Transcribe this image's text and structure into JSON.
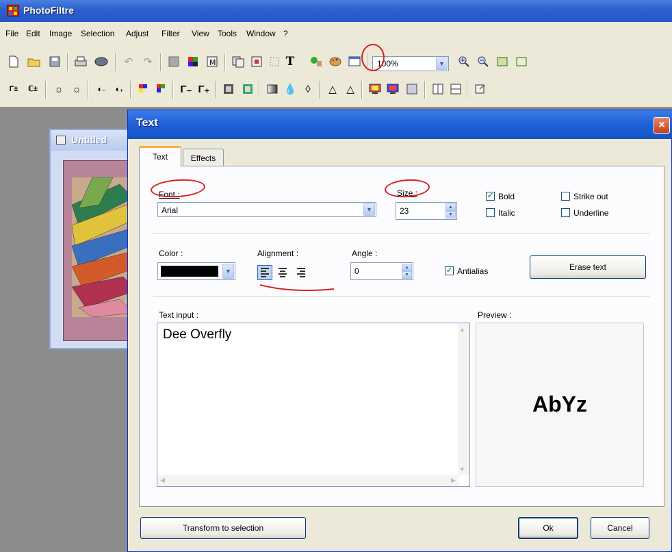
{
  "app": {
    "title": "PhotoFiltre"
  },
  "menu": [
    "File",
    "Edit",
    "Image",
    "Selection",
    "Adjust",
    "Filter",
    "View",
    "Tools",
    "Window",
    "?"
  ],
  "toolbar": {
    "zoom_value": "100%",
    "row1_icons": [
      "new-icon",
      "open-icon",
      "save-icon",
      "print-icon",
      "scan-icon",
      "undo-icon",
      "redo-icon",
      "grey-square-icon",
      "color-grid-icon",
      "mask-icon",
      "copy-icon",
      "paste-icon",
      "crop-icon",
      "text-icon",
      "tree-icon",
      "palette-icon",
      "window-icon",
      "zoom-in-icon",
      "zoom-out-icon",
      "fit-icon",
      "actual-size-icon"
    ],
    "row2_icons": [
      "auto-levels-icon",
      "auto-contrast-icon",
      "brightness-minus-icon",
      "brightness-plus-icon",
      "contrast-minus-icon",
      "contrast-plus-icon",
      "saturation-minus-icon",
      "saturation-plus-icon",
      "gamma-minus-icon",
      "gamma-plus-icon",
      "grayscale-icon",
      "color-grid-icon",
      "gradient-icon",
      "drop-icon",
      "drop-outline-icon",
      "triangle-icon",
      "triangle-outline-icon",
      "monitor-icon",
      "monitor-alt-icon",
      "dither-icon",
      "book-icon",
      "frame-icon",
      "export-icon"
    ]
  },
  "image_window": {
    "title": "Untitled"
  },
  "dialog": {
    "title": "Text",
    "close": "×",
    "tabs": [
      {
        "label": "Text",
        "active": true
      },
      {
        "label": "Effects",
        "active": false
      }
    ],
    "font": {
      "label": "Font :",
      "value": "Arial"
    },
    "size": {
      "label": "Size :",
      "value": "23"
    },
    "style": {
      "bold": {
        "label": "Bold",
        "checked": true
      },
      "italic": {
        "label": "Italic",
        "checked": false
      },
      "strikeout": {
        "label": "Strike out",
        "checked": false
      },
      "underline": {
        "label": "Underline",
        "checked": false
      }
    },
    "color": {
      "label": "Color :",
      "value": "#000000"
    },
    "alignment": {
      "label": "Alignment :",
      "selected": "left"
    },
    "angle": {
      "label": "Angle :",
      "value": "0"
    },
    "antialias": {
      "label": "Antialias",
      "checked": true
    },
    "erase_button": "Erase text",
    "text_input": {
      "label": "Text input :",
      "value": "Dee Overfly"
    },
    "preview": {
      "label": "Preview :",
      "sample": "AbYz"
    },
    "transform_button": "Transform to selection",
    "ok_button": "Ok",
    "cancel_button": "Cancel"
  },
  "annotation_color": "#d62020"
}
